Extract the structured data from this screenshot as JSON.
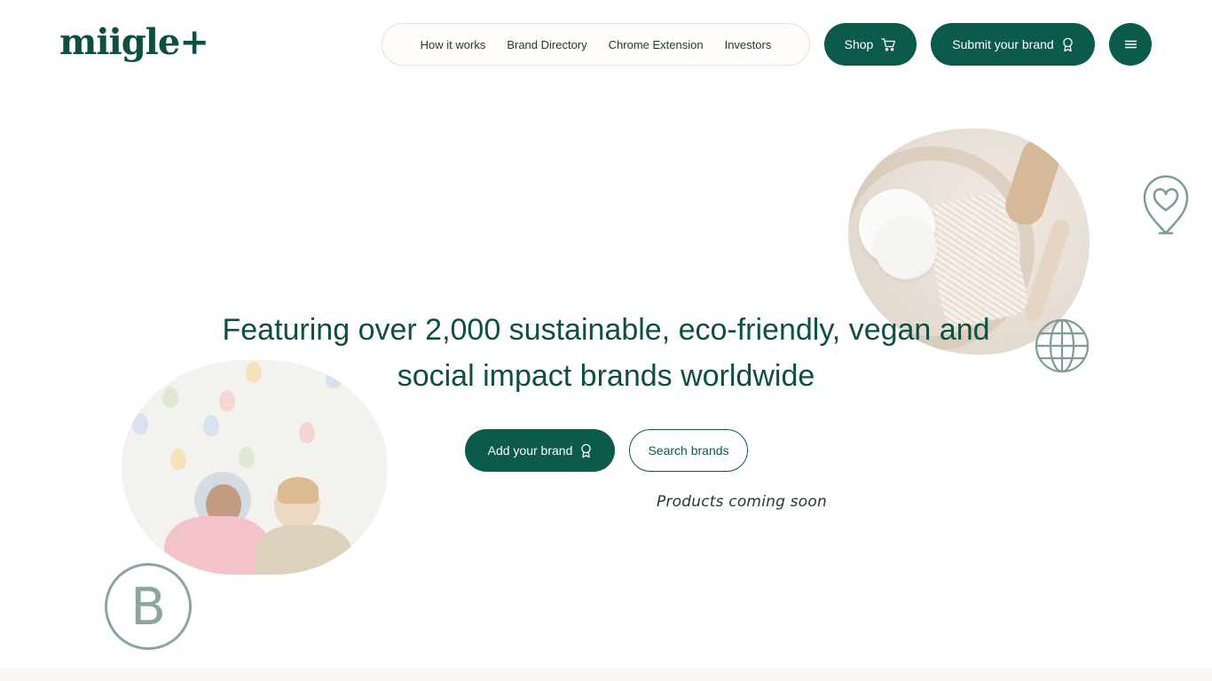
{
  "brand": {
    "logo_text": "miigle+"
  },
  "nav": {
    "links": [
      {
        "label": "How it works"
      },
      {
        "label": "Brand Directory"
      },
      {
        "label": "Chrome Extension"
      },
      {
        "label": "Investors"
      }
    ],
    "shop_label": "Shop",
    "submit_label": "Submit your brand",
    "menu_icon": "hamburger-menu-icon"
  },
  "hero": {
    "headline_line1": "Featuring over 2,000 sustainable, eco-friendly, vegan and",
    "headline_line2": "social impact brands worldwide",
    "add_brand_label": "Add your brand",
    "search_brands_label": "Search brands",
    "coming_soon": "Products coming soon"
  },
  "decor": {
    "badge_letter": "B",
    "icons": [
      "heart-pin-icon",
      "globe-icon",
      "cart-icon",
      "award-icon"
    ]
  },
  "colors": {
    "primary": "#0b5a4c",
    "muted_icon": "#8aa69f",
    "nav_bg": "#fffcf9"
  }
}
